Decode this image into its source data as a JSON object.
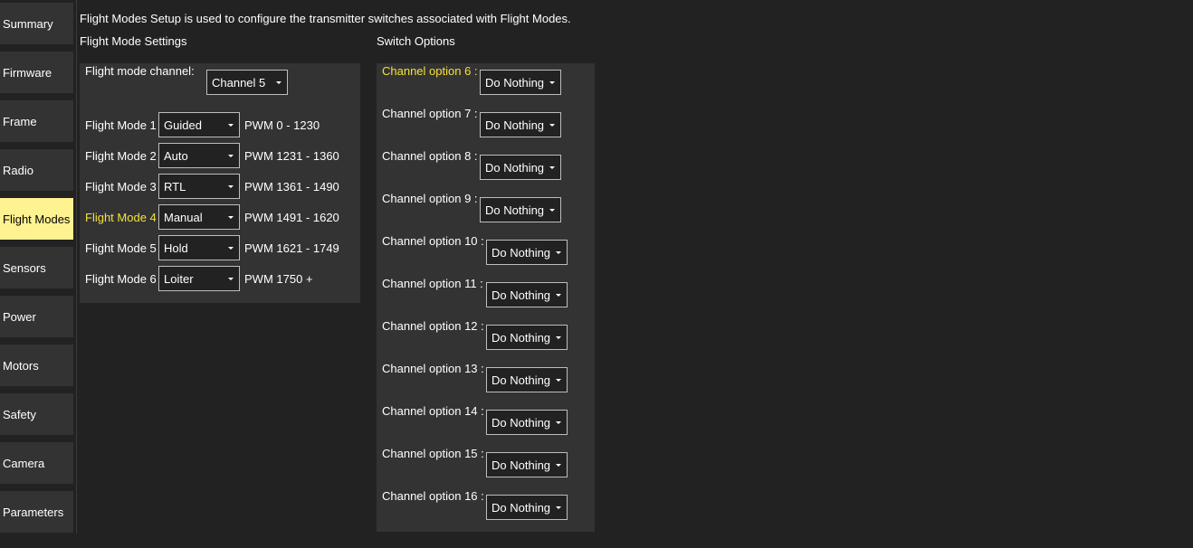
{
  "sidebar": {
    "items": [
      {
        "label": "Summary"
      },
      {
        "label": "Firmware"
      },
      {
        "label": "Frame"
      },
      {
        "label": "Radio"
      },
      {
        "label": "Flight Modes"
      },
      {
        "label": "Sensors"
      },
      {
        "label": "Power"
      },
      {
        "label": "Motors"
      },
      {
        "label": "Safety"
      },
      {
        "label": "Camera"
      },
      {
        "label": "Parameters"
      }
    ],
    "active": "Flight Modes"
  },
  "header": {
    "description": "Flight Modes Setup is used to configure the transmitter switches associated with Flight Modes."
  },
  "flight_mode_settings": {
    "title": "Flight Mode Settings",
    "channel_label": "Flight mode channel:",
    "channel_value": "Channel 5",
    "modes": [
      {
        "label": "Flight Mode 1",
        "value": "Guided",
        "pwm": "PWM 0 - 1230"
      },
      {
        "label": "Flight Mode 2",
        "value": "Auto",
        "pwm": "PWM 1231 - 1360"
      },
      {
        "label": "Flight Mode 3",
        "value": "RTL",
        "pwm": "PWM 1361 - 1490"
      },
      {
        "label": "Flight Mode 4",
        "value": "Manual",
        "pwm": "PWM 1491 - 1620",
        "active": true
      },
      {
        "label": "Flight Mode 5",
        "value": "Hold",
        "pwm": "PWM 1621 - 1749"
      },
      {
        "label": "Flight Mode 6",
        "value": "Loiter",
        "pwm": "PWM 1750 +"
      }
    ]
  },
  "switch_options": {
    "title": "Switch Options",
    "channels": [
      {
        "label": "Channel option 6 :",
        "value": "Do Nothing",
        "active": true
      },
      {
        "label": "Channel option 7 :",
        "value": "Do Nothing"
      },
      {
        "label": "Channel option 8 :",
        "value": "Do Nothing"
      },
      {
        "label": "Channel option 9 :",
        "value": "Do Nothing"
      },
      {
        "label": "Channel option 10 :",
        "value": "Do Nothing"
      },
      {
        "label": "Channel option 11 :",
        "value": "Do Nothing"
      },
      {
        "label": "Channel option 12 :",
        "value": "Do Nothing"
      },
      {
        "label": "Channel option 13 :",
        "value": "Do Nothing"
      },
      {
        "label": "Channel option 14 :",
        "value": "Do Nothing"
      },
      {
        "label": "Channel option 15 :",
        "value": "Do Nothing"
      },
      {
        "label": "Channel option 16 :",
        "value": "Do Nothing"
      }
    ]
  },
  "colors": {
    "background": "#222222",
    "panel": "#333333",
    "active_nav": "#fff291",
    "highlight_text": "#f5e13a"
  }
}
